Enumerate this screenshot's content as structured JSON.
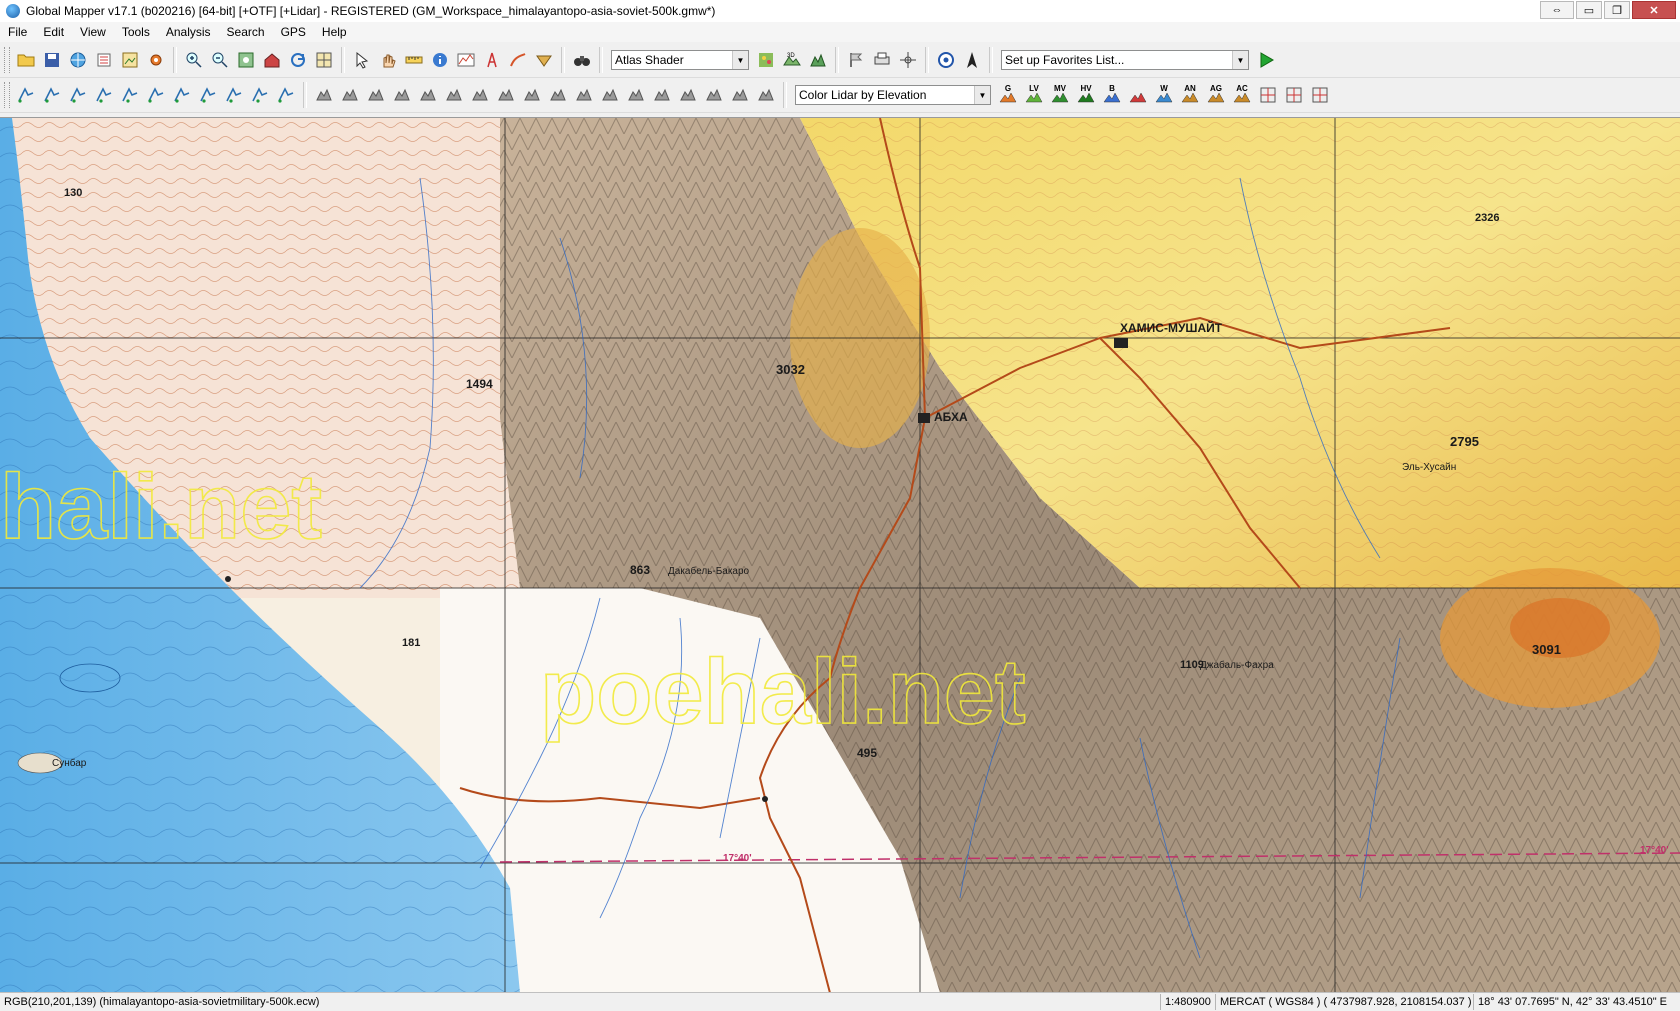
{
  "window": {
    "title": "Global Mapper v17.1 (b020216) [64-bit] [+OTF] [+Lidar] - REGISTERED (GM_Workspace_himalayantopo-asia-soviet-500k.gmw*)",
    "controls": {
      "restore": "⇔",
      "minimize": "▭",
      "maximize": "❐",
      "close": "✕"
    }
  },
  "menu": [
    "File",
    "Edit",
    "View",
    "Tools",
    "Analysis",
    "Search",
    "GPS",
    "Help"
  ],
  "toolbar1": {
    "shader": "Atlas Shader",
    "favorites": "Set up Favorites List..."
  },
  "toolbar2": {
    "lidar_color": "Color Lidar by Elevation",
    "class_buttons": [
      "G",
      "LV",
      "MV",
      "HV",
      "B",
      "",
      "W",
      "AN",
      "AG",
      "AC"
    ]
  },
  "map": {
    "labels": {
      "hamis": "ХАМИС-МУШАЙТ",
      "abha": "АБХА",
      "peak3032": "3032",
      "peak2795": "2795",
      "peak3091": "3091",
      "v1494": "1494",
      "v863": "863",
      "v495": "495",
      "v2326": "2326",
      "v130": "130",
      "v181": "181",
      "v1109": "1109",
      "lat_label_1": "17°40'",
      "lat_label_2": "17°40'",
      "place_dakhab": "Дакабель-Бакаро",
      "place_khusayn": "Эль-Хусайн",
      "place_ghamid": "Джабаль-Фахра",
      "place_sunbar": "Сунбар"
    },
    "watermark_1": "hali.net",
    "watermark_2": "poehali.net"
  },
  "status": {
    "rgb": "RGB(210,201,139) (himalayantopo-asia-sovietmilitary-500k.ecw)",
    "scale": "1:480900",
    "projection": "MERCAT ( WGS84 ) ( 4737987.928, 2108154.037 )",
    "coords": "18° 43' 07.7695\" N, 42° 33' 43.4510\" E"
  }
}
